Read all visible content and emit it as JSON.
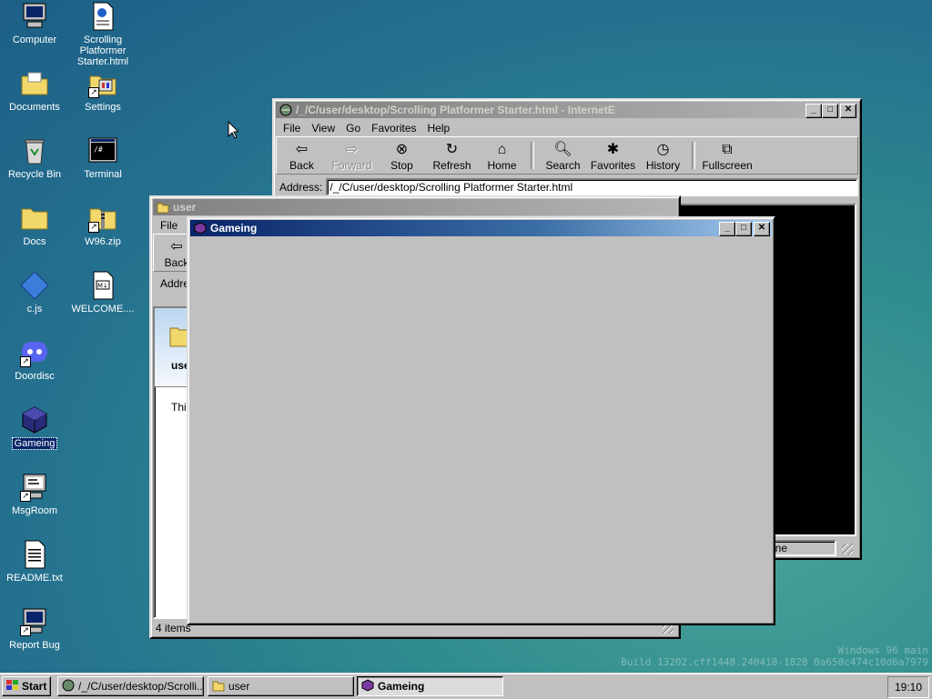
{
  "desktop": {
    "icons": [
      {
        "label": "Computer"
      },
      {
        "label": "Scrolling Platformer Starter.html"
      },
      {
        "label": "Documents"
      },
      {
        "label": "Settings"
      },
      {
        "label": "Recycle Bin"
      },
      {
        "label": "Terminal"
      },
      {
        "label": "Docs"
      },
      {
        "label": "W96.zip"
      },
      {
        "label": "c.js"
      },
      {
        "label": "WELCOME...."
      },
      {
        "label": "Doordisc"
      },
      {
        "label": "Gameing"
      },
      {
        "label": "MsgRoom"
      },
      {
        "label": "README.txt"
      },
      {
        "label": "Report Bug"
      }
    ],
    "watermark": {
      "line1": "Windows 96 main",
      "line2": "Build 13202.cff1448.240418-1828 0a650c474c10d6a7979"
    }
  },
  "browser": {
    "title": "/_/C/user/desktop/Scrolling Platformer Starter.html - InternetE",
    "menu": [
      "File",
      "View",
      "Go",
      "Favorites",
      "Help"
    ],
    "toolbar": {
      "back": "Back",
      "forward": "Forward",
      "stop": "Stop",
      "refresh": "Refresh",
      "home": "Home",
      "search": "Search",
      "favorites": "Favorites",
      "history": "History",
      "fullscreen": "Fullscreen"
    },
    "address_label": "Address:",
    "address_value": "/_/C/user/desktop/Scrolling Platformer Starter.html",
    "status_zone": "t Zone"
  },
  "explorer": {
    "title": "user",
    "menu_file": "File",
    "back": "Back",
    "address_label": "Addre",
    "folder_label": "user",
    "desc": "This",
    "status": "4 items"
  },
  "game": {
    "title": "Gameing"
  },
  "taskbar": {
    "start": "Start",
    "tasks": [
      {
        "label": "/_/C/user/desktop/Scrolli..."
      },
      {
        "label": "user"
      },
      {
        "label": "Gameing"
      }
    ],
    "clock": "19:10"
  }
}
